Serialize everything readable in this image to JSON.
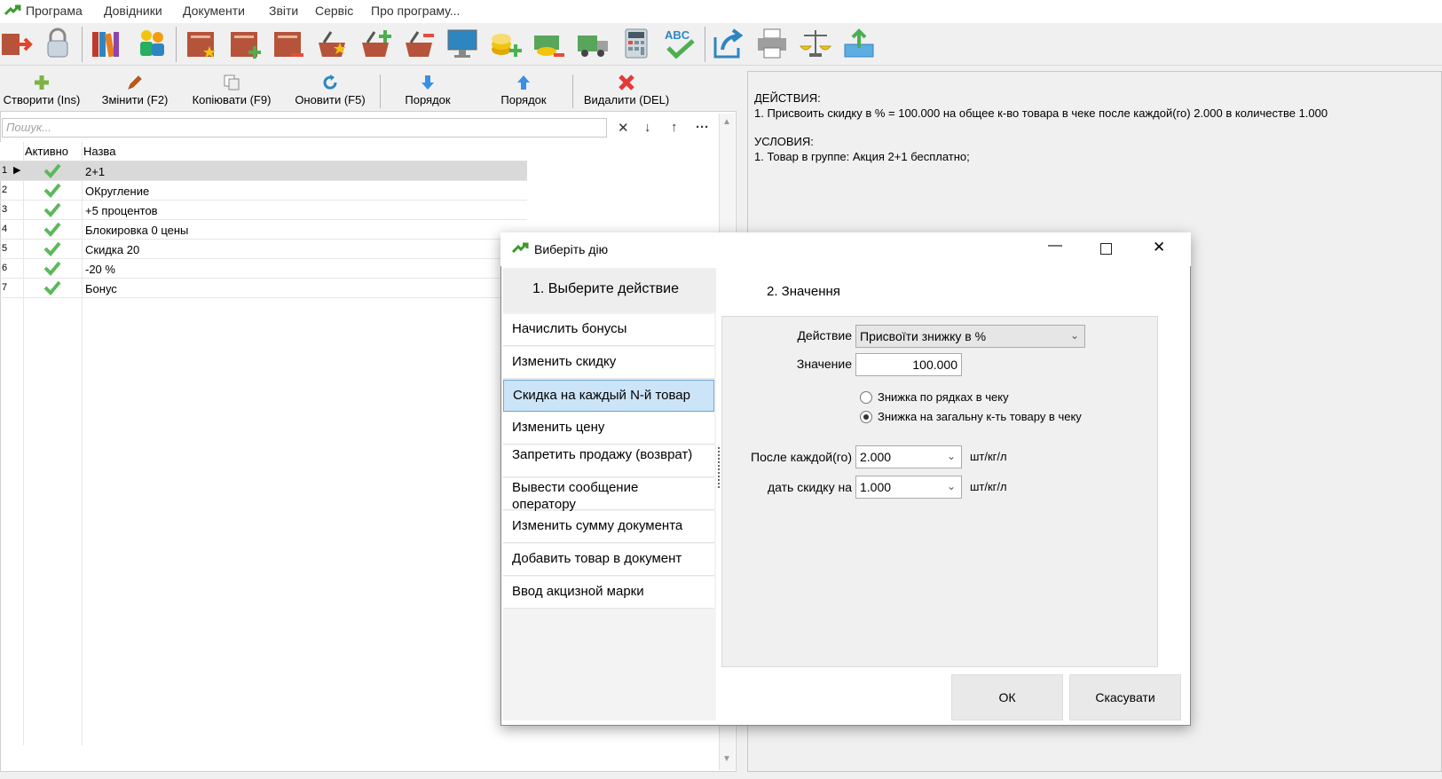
{
  "menu": {
    "items": [
      "Програма",
      "Довідники",
      "Документи",
      "Звіти",
      "Сервіс",
      "Про програму..."
    ]
  },
  "actions": {
    "create": "Створити (Ins)",
    "edit": "Змінити (F2)",
    "copy": "Копіювати (F9)",
    "refresh": "Оновити (F5)",
    "order_down": "Порядок",
    "order_up": "Порядок",
    "delete": "Видалити (DEL)"
  },
  "search": {
    "placeholder": "Пошук..."
  },
  "grid": {
    "headers": {
      "active": "Активно",
      "name": "Назва"
    },
    "rows": [
      {
        "num": "1",
        "name": "2+1"
      },
      {
        "num": "2",
        "name": "ОКругление"
      },
      {
        "num": "3",
        "name": "+5 процентов"
      },
      {
        "num": "4",
        "name": "Блокировка 0 цены"
      },
      {
        "num": "5",
        "name": "Скидка 20"
      },
      {
        "num": "6",
        "name": "-20 %"
      },
      {
        "num": "7",
        "name": "Бонус"
      }
    ]
  },
  "details": {
    "actions_title": "ДЕЙСТВИЯ:",
    "actions_line": "1. Присвоить скидку в % = 100.000 на общее к-во товара в чеке  после каждой(го) 2.000 в количестве 1.000",
    "conditions_title": "УСЛОВИЯ:",
    "conditions_line": "1. Товар в группе: Акция 2+1 бесплатно;"
  },
  "dialog": {
    "title": "Виберіть дію",
    "step1": "1. Выберите  действие",
    "step2": "2. Значення",
    "action_list": [
      "Начислить бонусы",
      "Изменить скидку",
      "Скидка на каждый N-й товар",
      "Изменить цену",
      "Запретить продажу (возврат)",
      "Вывести сообщение оператору",
      "Изменить сумму документа",
      "Добавить товар в документ",
      "Ввод акцизной марки"
    ],
    "form": {
      "action_label": "Действие",
      "action_value": "Присвоїти знижку в %",
      "value_label": "Значение",
      "value_value": "100.000",
      "radio1": "Знижка по рядках в чеку",
      "radio2": "Знижка на загальну к-ть товару в чеку",
      "after_label": "После каждой(го)",
      "after_value": "2.000",
      "after_unit": "шт/кг/л",
      "give_label": "дать скидку на",
      "give_value": "1.000",
      "give_unit": "шт/кг/л"
    },
    "ok": "ОК",
    "cancel": "Скасувати"
  }
}
